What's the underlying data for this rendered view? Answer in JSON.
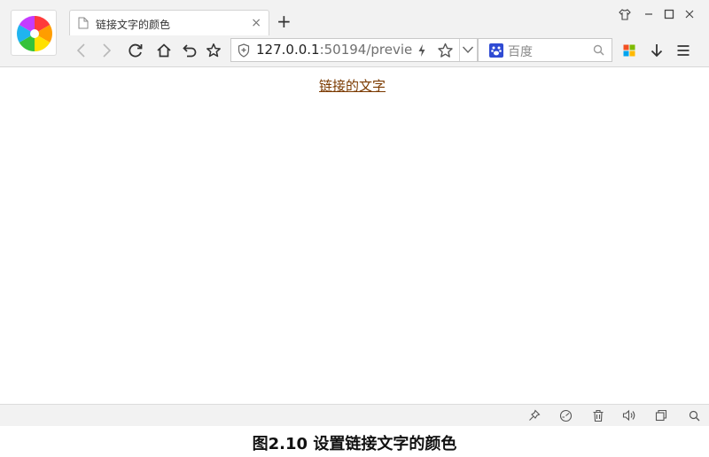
{
  "tab": {
    "title": "链接文字的颜色",
    "close_glyph": "×"
  },
  "new_tab_glyph": "+",
  "address_bar": {
    "host": "127.0.0.1",
    "rest": ":50194/previe"
  },
  "search_box": {
    "placeholder": "百度",
    "engine_icon": "baidu-paw-icon"
  },
  "page": {
    "link_text": "链接的文字",
    "link_color": "#7b3a00"
  },
  "caption": "图2.10  设置链接文字的颜色",
  "icons": {
    "window": [
      "skin-icon",
      "minimize-icon",
      "maximize-icon",
      "close-icon"
    ],
    "nav": [
      "back-icon",
      "forward-icon",
      "reload-icon",
      "home-icon",
      "undo-icon",
      "favorite-icon"
    ],
    "toolbar_right": [
      "apps-grid-icon",
      "download-icon",
      "menu-icon"
    ],
    "status": [
      "pin-icon",
      "speed-icon",
      "trash-icon",
      "volume-icon",
      "restore-icon",
      "zoom-icon"
    ]
  }
}
